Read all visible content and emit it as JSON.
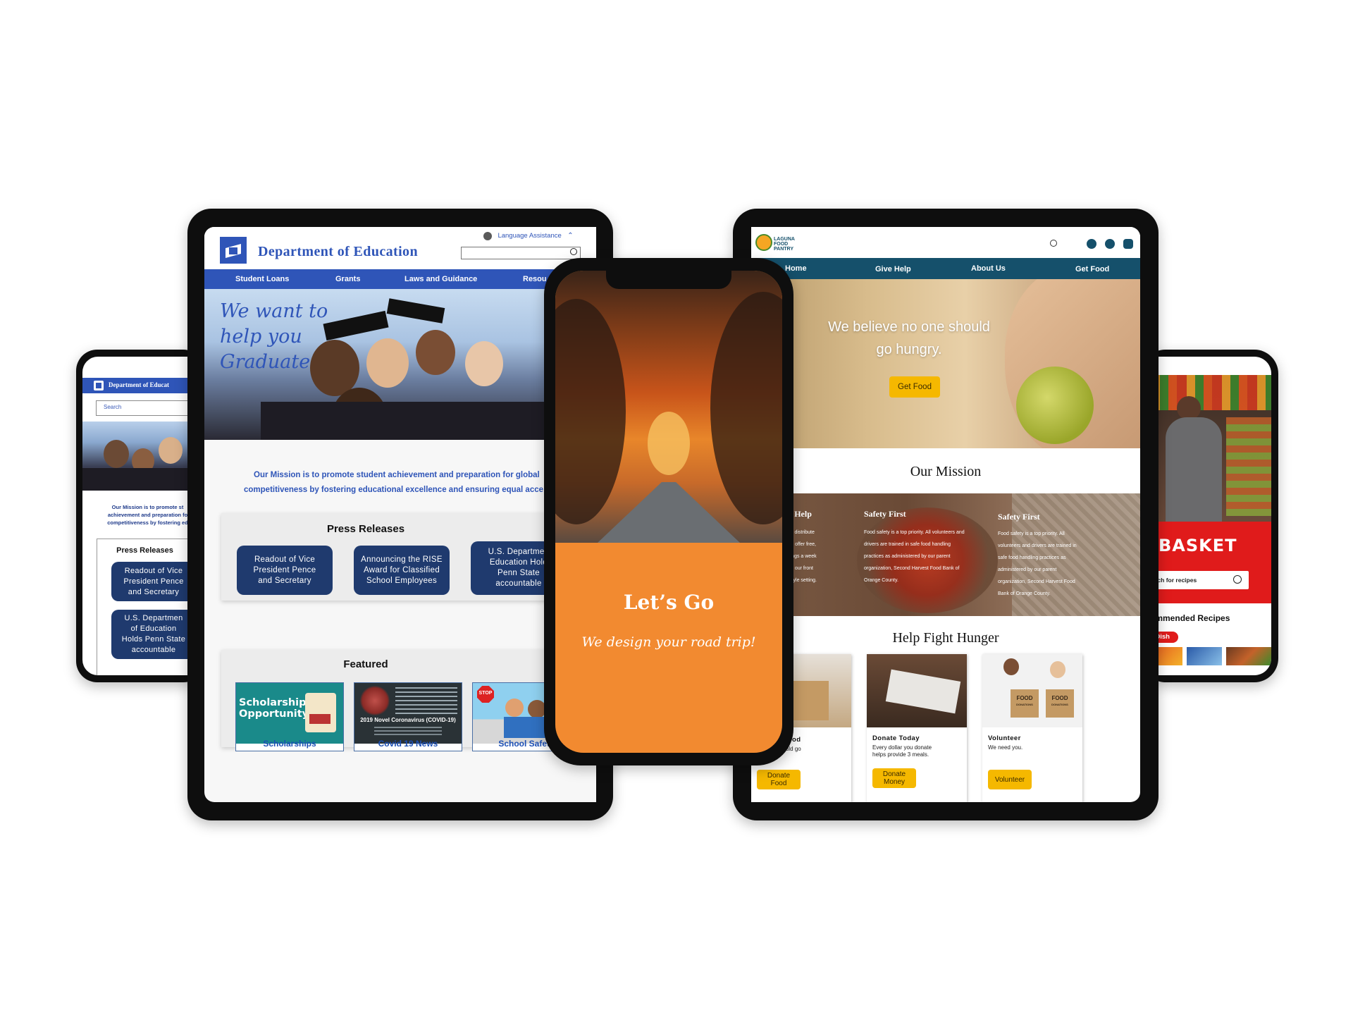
{
  "colors": {
    "edu_blue": "#2f55b8",
    "edu_navy": "#1f3a6e",
    "orange": "#f28a30",
    "laguna_teal": "#15506b",
    "gold": "#f5b800",
    "basket_red": "#e01b1b"
  },
  "edu": {
    "title": "Department of Education",
    "language": "Language Assistance",
    "nav": [
      "Student Loans",
      "Grants",
      "Laws and Guidance",
      "Resou"
    ],
    "hero": [
      "We want to",
      "help you",
      "Graduate"
    ],
    "mission": [
      "Our Mission is to promote student achievement and preparation for global",
      "competitiveness by fostering educational excellence and ensuring equal acce"
    ],
    "press_title": "Press Releases",
    "press": [
      [
        "Readout of Vice",
        "President Pence",
        "and Secretary"
      ],
      [
        "Announcing the RISE",
        "Award for Classified",
        "School Employees"
      ],
      [
        "U.S. Departmen",
        "Education Hold",
        "Penn State",
        "accountable"
      ]
    ],
    "featured_title": "Featured",
    "featured": [
      "Scholarships",
      "Covid 19 News",
      "School Safety"
    ],
    "scholar_img": [
      "Scholarship",
      "Opportunity"
    ],
    "covid_img": "2019 Novel Coronavirus (COVID-19)",
    "stop": "STOP"
  },
  "edu_phone": {
    "title": "Department of Educat",
    "search": "Search",
    "mission": [
      "Our Mission is to promote st",
      "achievement and preparation fo",
      "competitiveness by fostering ed"
    ],
    "press_title": "Press Releases",
    "press": [
      [
        "Readout of Vice",
        "President Pence",
        "and Secretary"
      ],
      [
        "U.S. Departmen",
        "of Education",
        "Holds Penn State",
        "accountable"
      ]
    ]
  },
  "road": {
    "title": "Let’s Go",
    "subtitle": "We design your road trip!"
  },
  "laguna": {
    "logo": [
      "LAGUNA",
      "FOOD",
      "PANTRY"
    ],
    "nav": [
      "Home",
      "Give Help",
      "About Us",
      "Get Food"
    ],
    "hero": [
      "We believe no one should",
      "go hungry."
    ],
    "hero_btn": "Get Food",
    "mission_title": "Our Mission",
    "cols": [
      {
        "title": "are Hear to Help",
        "text": [
          "ion is to collect and distribute",
          "people in need. We offer free,",
          "roceries five mornings a week",
          "one who signs in at our front",
          "shop in our retail-style setting."
        ]
      },
      {
        "title": "Safety First",
        "text": [
          "Food safety is a top priority. All volunteers and",
          "drivers are trained in safe food handling",
          "practices as administered by our parent",
          "organization, Second Harvest Food Bank of",
          "Orange County."
        ]
      },
      {
        "title": "Safety First",
        "text": [
          "Food safety is a top priority. All",
          "volunteers and drivers are trained in",
          "safe food handling practices as",
          "administered by our parent",
          "organization, Second Harvest Food",
          "Bank of Orange County."
        ]
      }
    ],
    "help_title": "Help Fight Hunger",
    "cards": [
      {
        "title": "Donate Food",
        "text": [
          "No one should go",
          "hungry"
        ],
        "btn": [
          "Donate",
          "Food"
        ]
      },
      {
        "title": "Donate Today",
        "text": [
          "Every dollar you donate",
          "helps provide 3 meals."
        ],
        "btn": [
          "Donate",
          "Money"
        ]
      },
      {
        "title": "Volunteer",
        "text": [
          "We need you."
        ],
        "btn": [
          "Volunteer"
        ]
      }
    ],
    "box_label": [
      "FOOD",
      "DONATIONS"
    ]
  },
  "basket": {
    "title": "BASKET",
    "search": "Search for recipes",
    "recommended": "Recommended Recipes",
    "chip": "ain Dish"
  }
}
